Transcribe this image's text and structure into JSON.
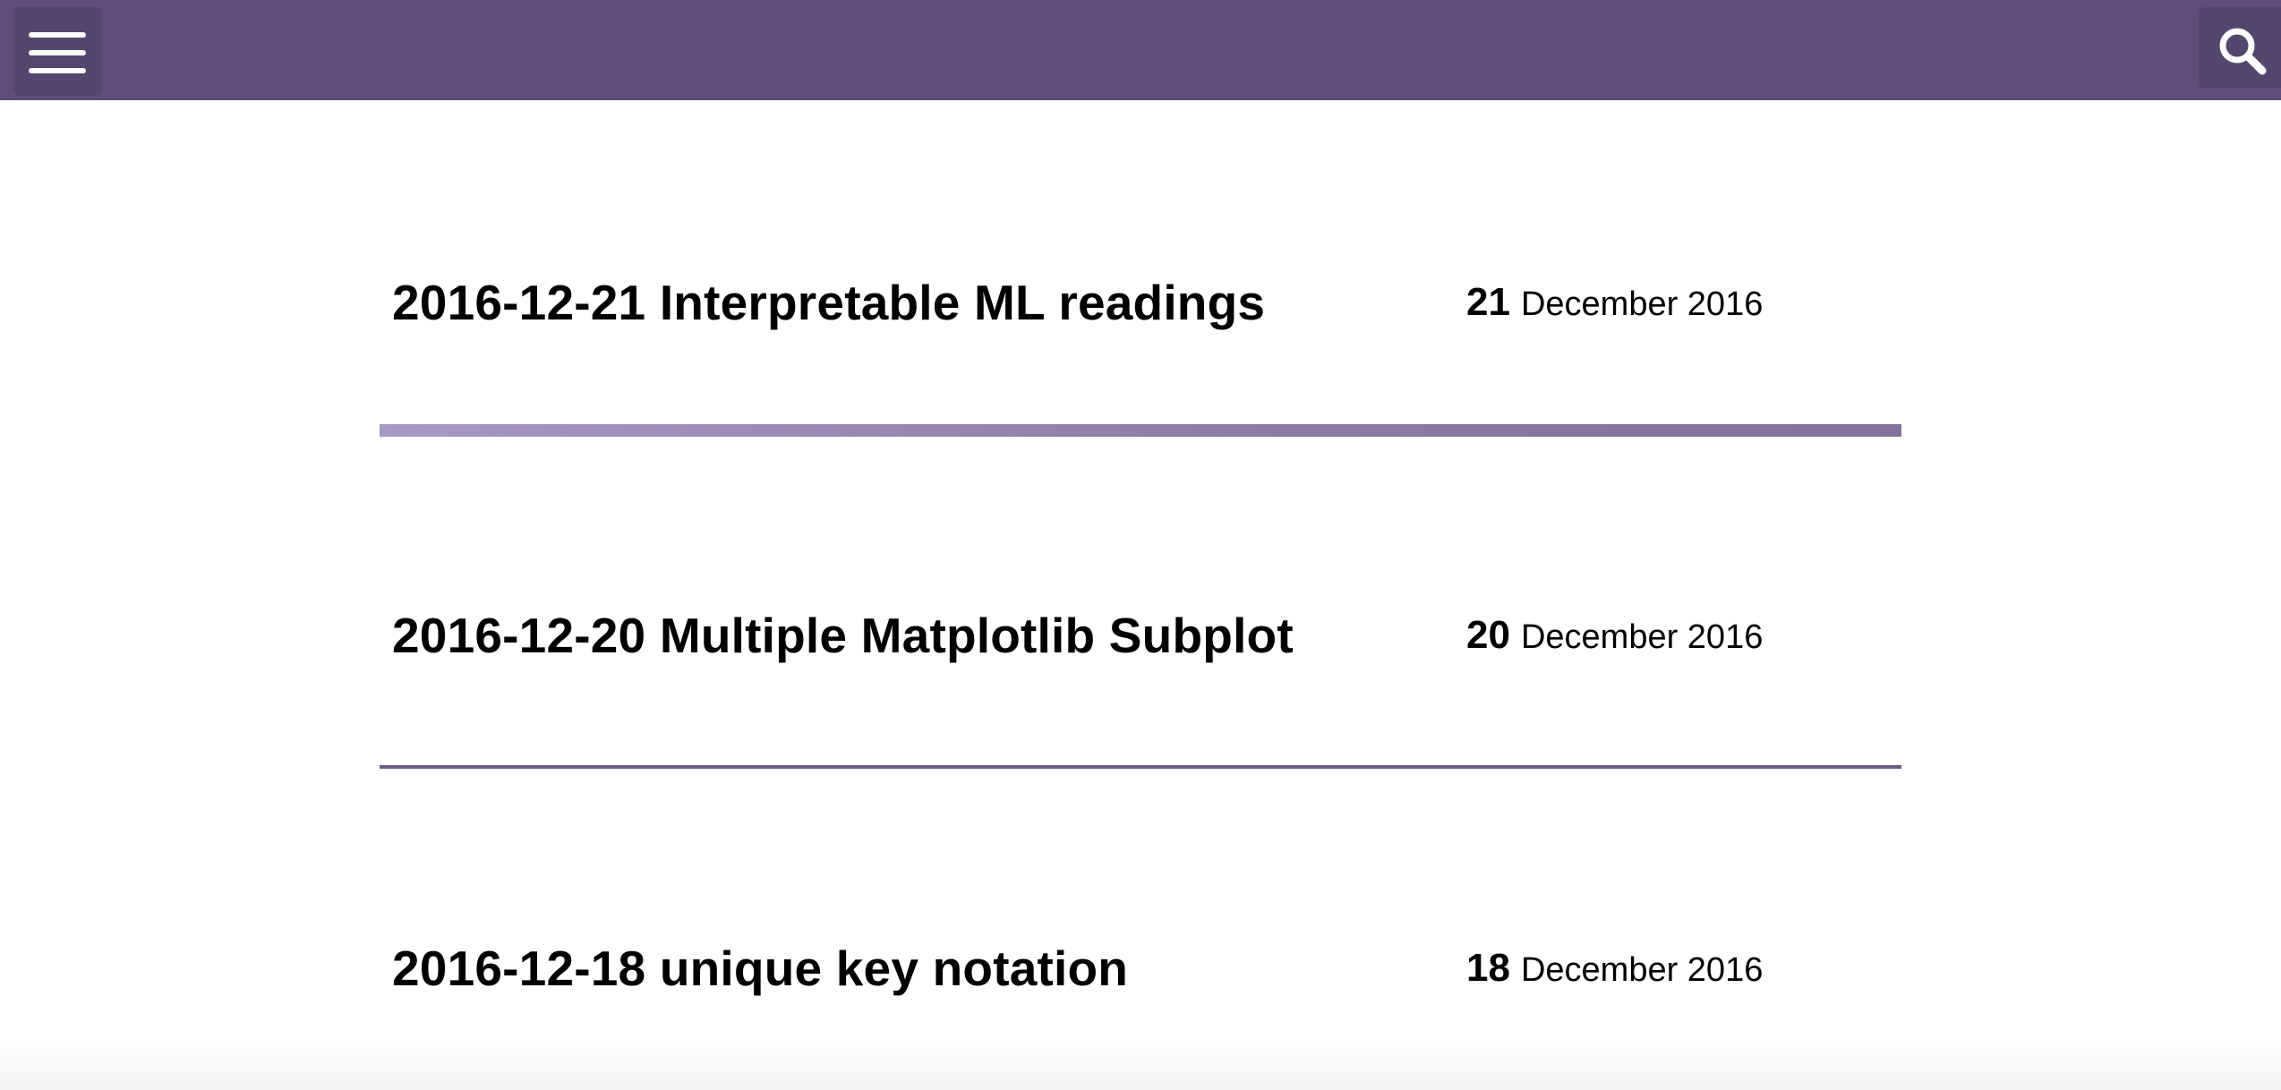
{
  "header": {
    "menu_icon": "hamburger-menu-icon",
    "search_icon": "search-icon",
    "background_color": "#5e4f7a"
  },
  "posts": [
    {
      "title": "2016-12-21 Interpretable ML readings",
      "day": "21",
      "month_year": "December 2016"
    },
    {
      "title": "2016-12-20 Multiple Matplotlib Subplot",
      "day": "20",
      "month_year": "December 2016"
    },
    {
      "title": "2016-12-18 unique key notation",
      "day": "18",
      "month_year": "December 2016"
    }
  ],
  "colors": {
    "separator_light": "#a699c4",
    "separator_dark": "#6b5d88"
  }
}
